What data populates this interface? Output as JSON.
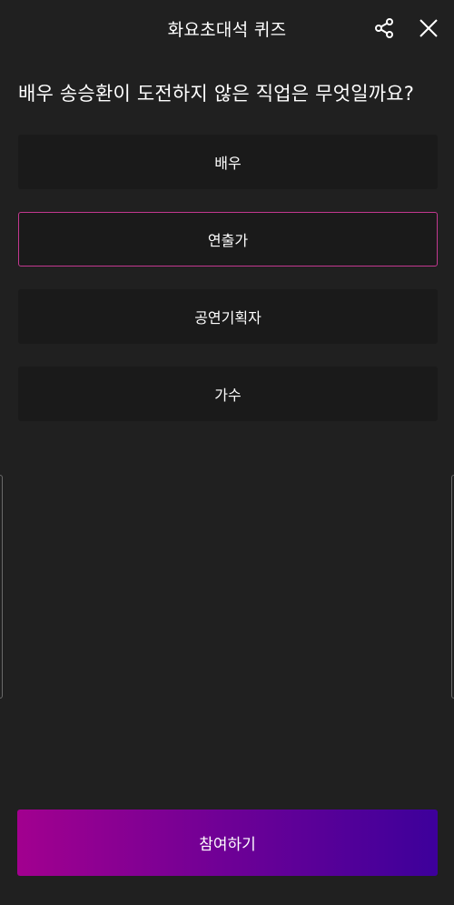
{
  "header": {
    "title": "화요초대석 퀴즈",
    "share_icon": "share-icon",
    "close_icon": "close-icon"
  },
  "question": "배우 송승환이 도전하지 않은 직업은 무엇일까요?",
  "options": [
    {
      "label": "배우",
      "selected": false
    },
    {
      "label": "연출가",
      "selected": true
    },
    {
      "label": "공연기획자",
      "selected": false
    },
    {
      "label": "가수",
      "selected": false
    }
  ],
  "join_button": {
    "label": "참여하기"
  },
  "colors": {
    "background": "#202020",
    "option_background": "#1a1a1a",
    "selected_border": "#c2388f",
    "button_gradient_start": "#a2008f",
    "button_gradient_end": "#3d009b"
  }
}
